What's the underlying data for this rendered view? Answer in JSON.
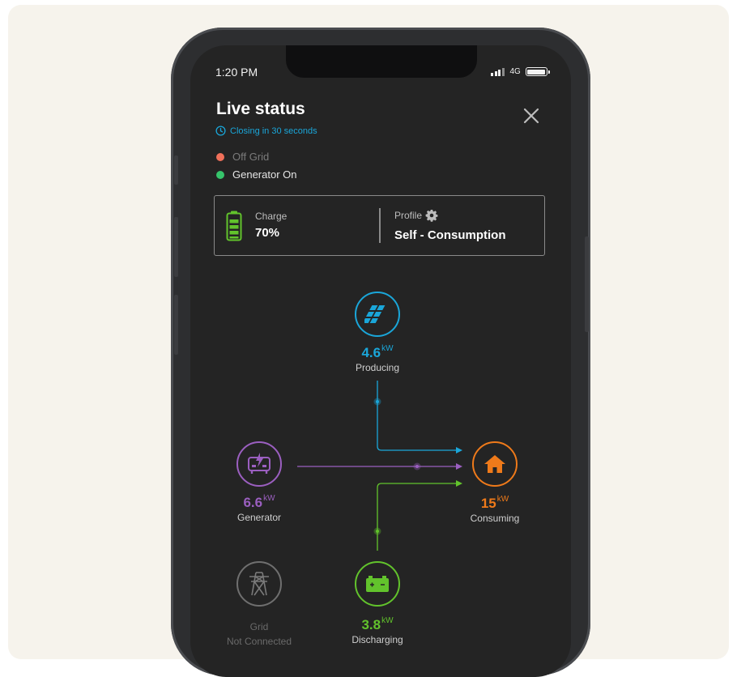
{
  "status_bar": {
    "time": "1:20 PM",
    "network": "4G"
  },
  "header": {
    "title": "Live status",
    "countdown": "Closing in 30 seconds"
  },
  "legend": [
    {
      "label": "Off Grid",
      "color": "#f0705a",
      "text_color": "#7b7b7b"
    },
    {
      "label": "Generator On",
      "color": "#36c46b",
      "text_color": "#e6e6e6"
    }
  ],
  "charge": {
    "label": "Charge",
    "value": "70%"
  },
  "profile": {
    "label": "Profile",
    "value": "Self - Consumption"
  },
  "nodes": {
    "solar": {
      "value": "4.6",
      "unit": "kW",
      "caption": "Producing",
      "color": "#1aa6d9"
    },
    "generator": {
      "value": "6.6",
      "unit": "kW",
      "caption": "Generator",
      "color": "#9b5fc0"
    },
    "home": {
      "value": "15",
      "unit": "kW",
      "caption": "Consuming",
      "color": "#ef7a1a"
    },
    "battery": {
      "value": "3.8",
      "unit": "kW",
      "caption": "Discharging",
      "color": "#62c32c"
    },
    "grid": {
      "caption_line1": "Grid",
      "caption_line2": "Not Connected",
      "color": "#6f6f6f"
    }
  },
  "icons": [
    "clock-icon",
    "close-icon",
    "battery-charge-icon",
    "gear-icon",
    "solar-panel-icon",
    "generator-icon",
    "house-icon",
    "battery-icon",
    "power-tower-icon"
  ]
}
